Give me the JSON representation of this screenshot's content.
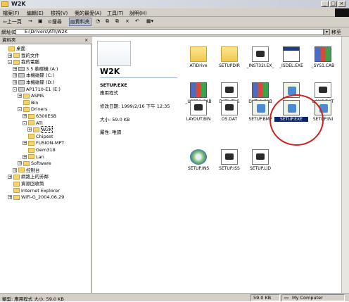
{
  "window": {
    "title": "W2K"
  },
  "menu": [
    "檔案(F)",
    "編輯(E)",
    "檢視(V)",
    "我的最愛(A)",
    "工具(T)",
    "說明(H)"
  ],
  "toolbar": {
    "back": "上一頁",
    "search": "搜尋",
    "folders": "資料夾"
  },
  "address": {
    "label": "網址(D)",
    "value": "E:\\Drivers\\ATI\\W2K",
    "go": "移至"
  },
  "folder_pane": {
    "title": "資料夾",
    "close": "×",
    "tree": [
      {
        "label": "桌面",
        "depth": 0,
        "exp": ""
      },
      {
        "label": "我的文件",
        "depth": 1,
        "exp": "+"
      },
      {
        "label": "我的電腦",
        "depth": 1,
        "exp": "−"
      },
      {
        "label": "3.5 軟碟機 (A:)",
        "depth": 2,
        "exp": "+"
      },
      {
        "label": "本機磁碟 (C:)",
        "depth": 2,
        "exp": "+"
      },
      {
        "label": "本機磁碟 (D:)",
        "depth": 2,
        "exp": "+"
      },
      {
        "label": "AP1710-E1 (E:)",
        "depth": 2,
        "exp": "−"
      },
      {
        "label": "ASMS",
        "depth": 3,
        "exp": "+"
      },
      {
        "label": "Bin",
        "depth": 3,
        "exp": ""
      },
      {
        "label": "Drivers",
        "depth": 3,
        "exp": "−"
      },
      {
        "label": "6300ESB",
        "depth": 4,
        "exp": "+"
      },
      {
        "label": "ATI",
        "depth": 4,
        "exp": "−"
      },
      {
        "label": "W2K",
        "depth": 5,
        "exp": "+"
      },
      {
        "label": "Chipset",
        "depth": 4,
        "exp": ""
      },
      {
        "label": "FUSION-MPT",
        "depth": 4,
        "exp": "+"
      },
      {
        "label": "Gem318",
        "depth": 4,
        "exp": ""
      },
      {
        "label": "Lan",
        "depth": 4,
        "exp": "+"
      },
      {
        "label": "Software",
        "depth": 3,
        "exp": "+"
      },
      {
        "label": "控制台",
        "depth": 2,
        "exp": "+"
      },
      {
        "label": "網路上的芳鄰",
        "depth": 1,
        "exp": "+"
      },
      {
        "label": "資源回收筒",
        "depth": 1,
        "exp": ""
      },
      {
        "label": "Internet Explorer",
        "depth": 1,
        "exp": ""
      },
      {
        "label": "WiFi-G_2004.06.29",
        "depth": 1,
        "exp": "+"
      }
    ]
  },
  "info": {
    "folder_name": "W2K",
    "file_name": "SETUP.EXE",
    "file_type": "應用程式",
    "modified": "修改日期: 1999/2/16 下午 12:35",
    "size": "大小: 59.0 KB",
    "attributes": "屬性: 唯讀"
  },
  "files": [
    {
      "name": "ATIDrive",
      "icon": "folder"
    },
    {
      "name": "SETUPDIR",
      "icon": "folder"
    },
    {
      "name": "_INST32I.EX_",
      "icon": "doc"
    },
    {
      "name": "_ISDEL.EXE",
      "icon": "app"
    },
    {
      "name": "_SYS1.CAB",
      "icon": "cab"
    },
    {
      "name": "_USER1.CAB",
      "icon": "cab"
    },
    {
      "name": "DATA.TAG",
      "icon": "doc"
    },
    {
      "name": "DATA1.CAB",
      "icon": "cab"
    },
    {
      "name": "",
      "icon": "setup"
    },
    {
      "name": "LANG.DAT",
      "icon": "doc"
    },
    {
      "name": "LAYOUT.BIN",
      "icon": "doc"
    },
    {
      "name": "OS.DAT",
      "icon": "doc"
    },
    {
      "name": "SETUP.BMP",
      "icon": "setup"
    },
    {
      "name": "SETUP.EXE",
      "icon": "setup",
      "selected": true
    },
    {
      "name": "SETUP.INI",
      "icon": "setup"
    },
    {
      "name": "SETUP.INS",
      "icon": "cd"
    },
    {
      "name": "SETUP.ISS",
      "icon": "doc"
    },
    {
      "name": "SETUP.LID",
      "icon": "doc"
    }
  ],
  "status": {
    "left": "類型: 應用程式 大小: 59.0 KB",
    "size": "59.0 KB",
    "zone": "My Computer"
  },
  "colors": {
    "selection": "#0a246a",
    "highlight_circle": "#d21f1f"
  }
}
